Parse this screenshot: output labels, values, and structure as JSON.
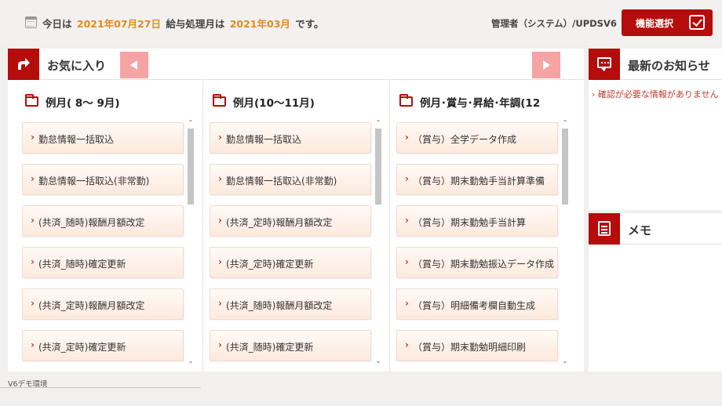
{
  "header": {
    "today_prefix": "今日は",
    "today_date": "2021年07月27日",
    "payroll_prefix": "給与処理月は",
    "payroll_month": "2021年03月",
    "suffix": "です。",
    "admin": "管理者（システム）/UPDSV6",
    "func_button": "機能選択"
  },
  "favorites": {
    "title": "お気に入り",
    "columns": [
      {
        "title": "例月( 8～ 9月)",
        "items": [
          {
            "label": "勤怠情報一括取込"
          },
          {
            "label": "勤怠情報一括取込(非常勤)"
          },
          {
            "label": "(共済_随時)報酬月額改定"
          },
          {
            "label": "(共済_随時)確定更新"
          },
          {
            "label": "(共済_定時)報酬月額改定"
          },
          {
            "label": "(共済_定時)確定更新"
          }
        ]
      },
      {
        "title": "例月(10～11月)",
        "items": [
          {
            "label": "勤怠情報一括取込"
          },
          {
            "label": "勤怠情報一括取込(非常勤)"
          },
          {
            "label": "(共済_定時)報酬月額改定"
          },
          {
            "label": "(共済_定時)確定更新"
          },
          {
            "label": "(共済_随時)報酬月額改定"
          },
          {
            "label": "(共済_随時)確定更新"
          }
        ]
      },
      {
        "title": "例月･賞与･昇給･年調(12",
        "items": [
          {
            "label": "（賞与）全学データ作成"
          },
          {
            "label": "（賞与）期末勤勉手当計算準備"
          },
          {
            "label": "（賞与）期末勤勉手当計算"
          },
          {
            "label": "（賞与）期末勤勉振込データ作成"
          },
          {
            "label": "（賞与）明細備考欄自動生成"
          },
          {
            "label": "（賞与）期末勤勉明細印刷"
          }
        ]
      }
    ]
  },
  "news": {
    "title": "最新のお知らせ",
    "message": "確認が必要な情報がありません"
  },
  "memo": {
    "title": "メモ"
  },
  "footer": "V6デモ環境",
  "colors": {
    "accent": "#b50c0c",
    "highlight": "#e38a1c",
    "nav_button": "#f5a3a3"
  }
}
